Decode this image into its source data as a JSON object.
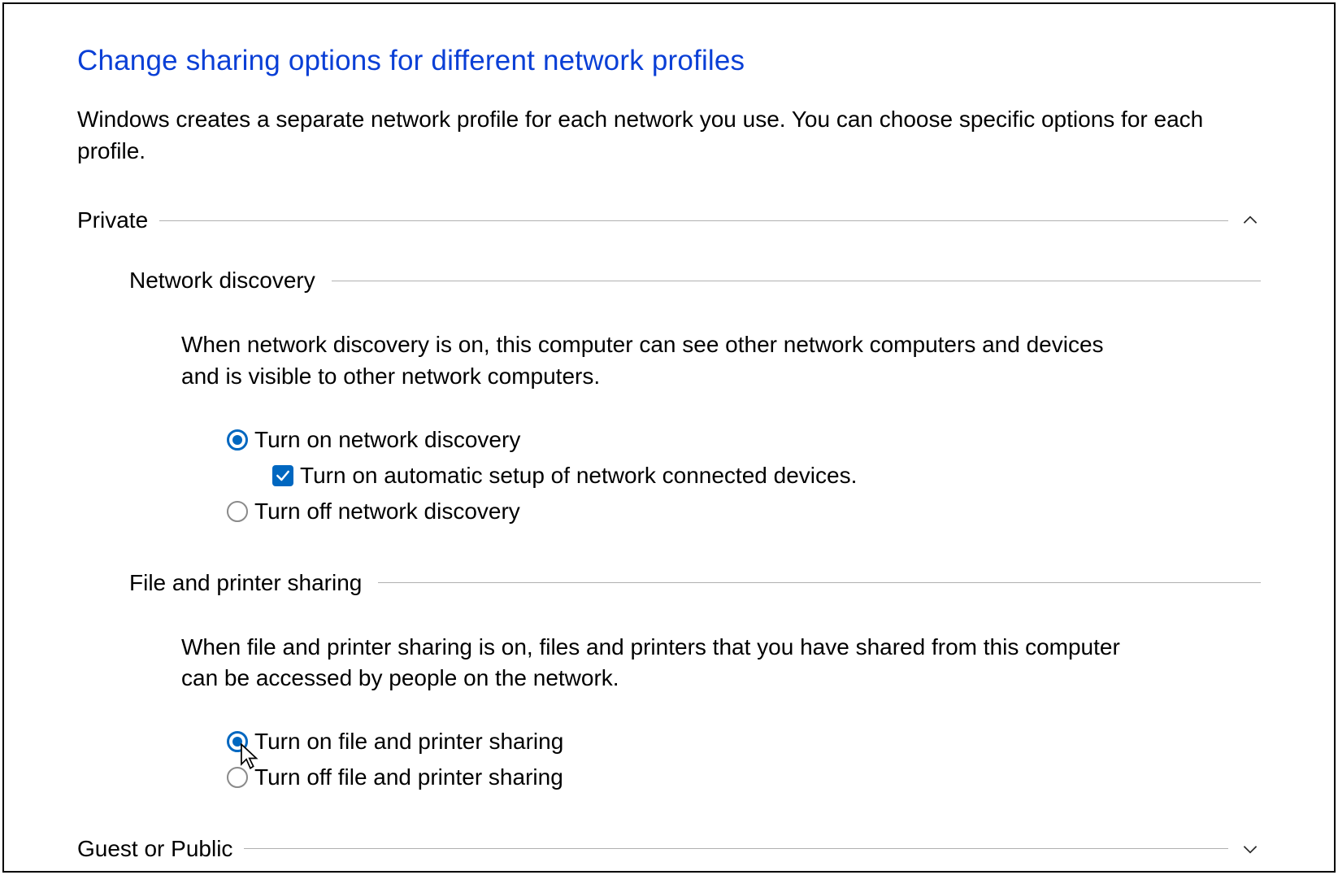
{
  "title": "Change sharing options for different network profiles",
  "description": "Windows creates a separate network profile for each network you use. You can choose specific options for each profile.",
  "sections": {
    "private": {
      "label": "Private",
      "expanded": true,
      "network_discovery": {
        "label": "Network discovery",
        "description": "When network discovery is on, this computer can see other network computers and devices and is visible to other network computers.",
        "option_on": "Turn on network discovery",
        "option_off": "Turn off network discovery",
        "selected": "on",
        "auto_setup_label": "Turn on automatic setup of network connected devices.",
        "auto_setup_checked": true
      },
      "file_printer_sharing": {
        "label": "File and printer sharing",
        "description": "When file and printer sharing is on, files and printers that you have shared from this computer can be accessed by people on the network.",
        "option_on": "Turn on file and printer sharing",
        "option_off": "Turn off file and printer sharing",
        "selected": "on"
      }
    },
    "guest_public": {
      "label": "Guest or Public",
      "expanded": false
    }
  },
  "colors": {
    "accent": "#0067c0",
    "title": "#0a3fd6"
  }
}
